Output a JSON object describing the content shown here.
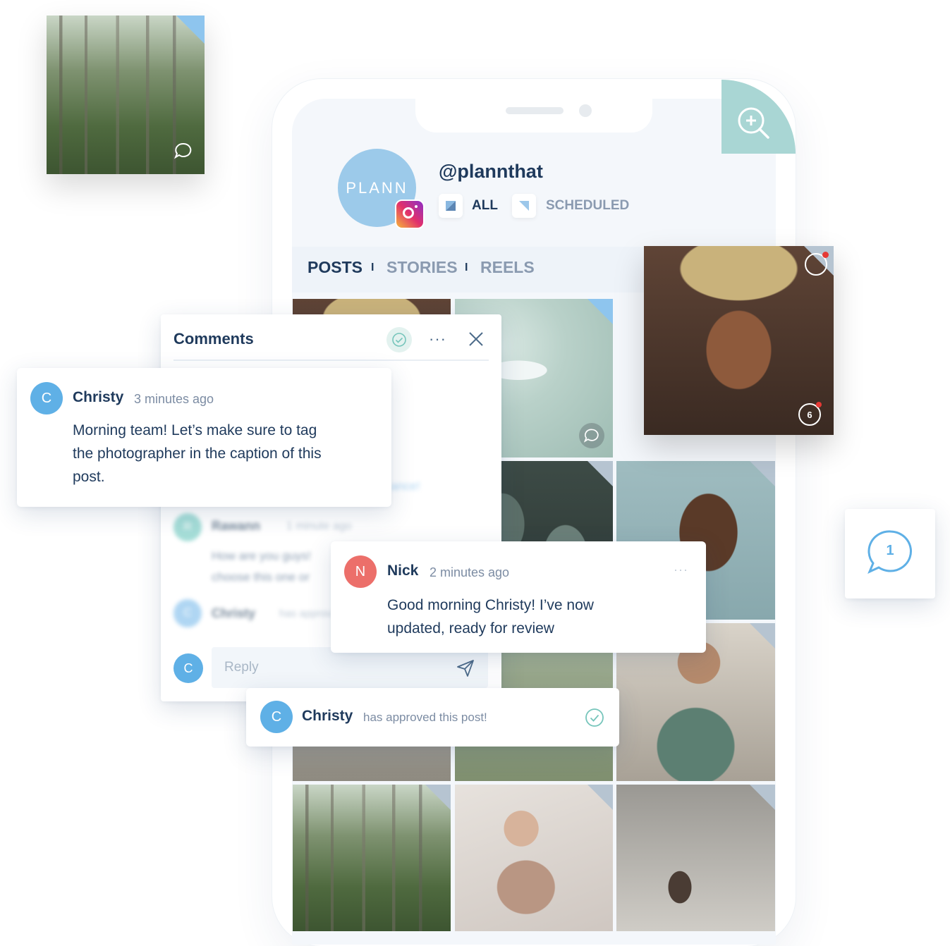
{
  "profile": {
    "logo_text": "PLANN",
    "handle": "@plannthat",
    "filter_all": "ALL",
    "filter_scheduled": "SCHEDULED"
  },
  "tabs": {
    "posts": "POSTS",
    "stories": "STORIES",
    "reels": "REELS",
    "separator": "I"
  },
  "comments_panel": {
    "title": "Comments",
    "reply_placeholder": "Reply",
    "reply_avatar": "C",
    "blurred": [
      {
        "initial": "R",
        "name": "Rawann",
        "time": "1 minute ago",
        "text": "How are you guys! choose this one or"
      },
      {
        "initial": "C",
        "name": "Christy",
        "time": "has approv"
      }
    ],
    "blurred_fragment": "ance!"
  },
  "comment_christy": {
    "initial": "C",
    "name": "Christy",
    "time": "3 minutes ago",
    "text": "Morning team! Let’s make sure to tag the photographer in the caption of this post."
  },
  "comment_nick": {
    "initial": "N",
    "name": "Nick",
    "time": "2 minutes ago",
    "text": "Good morning Christy! I’ve now updated, ready for review"
  },
  "approval": {
    "initial": "C",
    "name": "Christy",
    "text": "has approved this post!"
  },
  "badges": {
    "hat_photo_comments": "6",
    "floating_comment_count": "1"
  },
  "colors": {
    "accent": "#5fb0e6",
    "nick": "#ec6f6a",
    "teal": "#a9d6d4",
    "text": "#1f3a5c",
    "muted": "#7c8ca3"
  }
}
